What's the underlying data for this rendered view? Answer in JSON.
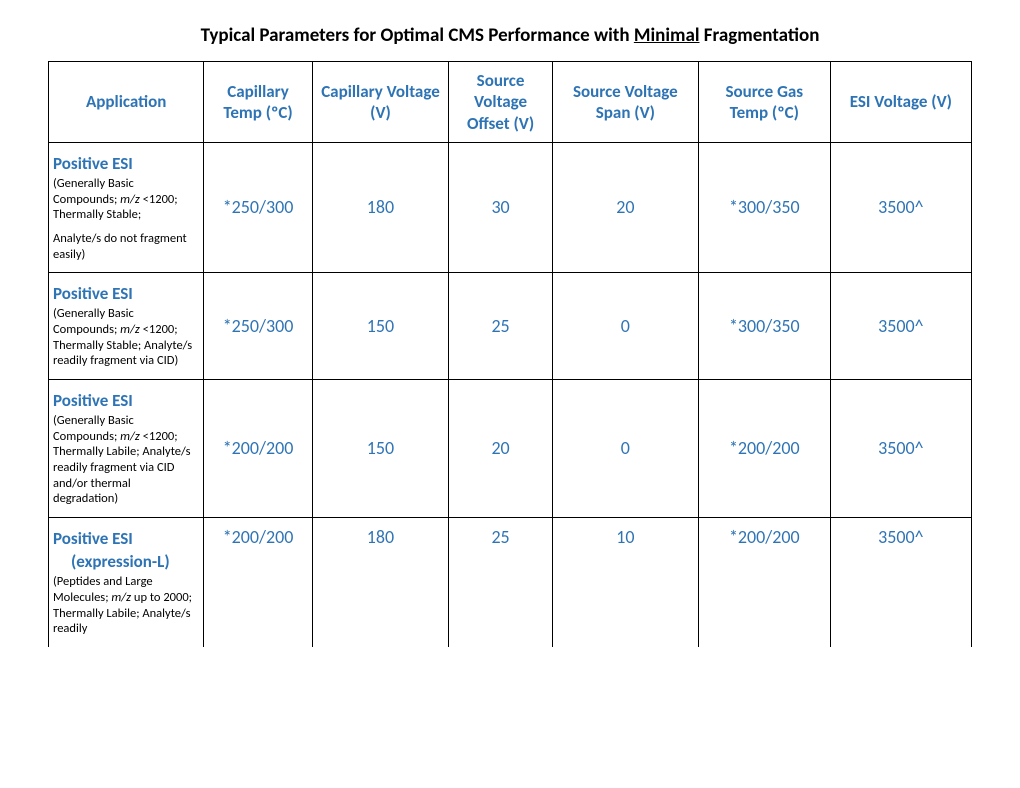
{
  "title_pre": "Typical Parameters for Optimal CMS Performance with ",
  "title_u": "Minimal",
  "title_post": " Fragmentation",
  "headers": {
    "application": "Application",
    "cap_temp": "Capillary Temp (ºC)",
    "cap_volt": "Capillary Voltage (V)",
    "src_v_off": "Source Voltage Offset (V)",
    "src_v_span": "Source Voltage Span (V)",
    "src_gas_temp": "Source Gas Temp (ºC)",
    "esi_v": "ESI Voltage (V)"
  },
  "rows": [
    {
      "app_name": "Positive ESI",
      "app_desc_1": "(Generally Basic Compounds; ",
      "app_desc_mz": "m/z",
      "app_desc_2": " <1200; Thermally Stable;",
      "app_desc_3": "Analyte/s do not fragment easily)",
      "cap_temp": "*250/300",
      "cap_volt": "180",
      "src_v_off": "30",
      "src_v_span": "20",
      "src_gas_temp": "*300/350",
      "esi_v": "3500^"
    },
    {
      "app_name": "Positive ESI",
      "app_desc_1": "(Generally Basic Compounds; ",
      "app_desc_mz": "m/z",
      "app_desc_2": " <1200; Thermally Stable; Analyte/s readily fragment via CID)",
      "app_desc_3": "",
      "cap_temp": "*250/300",
      "cap_volt": "150",
      "src_v_off": "25",
      "src_v_span": "0",
      "src_gas_temp": "*300/350",
      "esi_v": "3500^"
    },
    {
      "app_name": "Positive ESI",
      "app_desc_1": "(Generally Basic Compounds; ",
      "app_desc_mz": "m/z",
      "app_desc_2": " <1200; Thermally Labile; Analyte/s readily fragment via CID and/or thermal degradation)",
      "app_desc_3": "",
      "cap_temp": "*200/200",
      "cap_volt": "150",
      "src_v_off": "20",
      "src_v_span": "0",
      "src_gas_temp": "*200/200",
      "esi_v": "3500^"
    },
    {
      "app_name": "Positive ESI",
      "app_sub": "(expression-L)",
      "app_desc_1": "(Peptides and Large Molecules; ",
      "app_desc_mz": "m/z",
      "app_desc_2": " up to 2000; Thermally Labile; Analyte/s readily",
      "app_desc_3": "",
      "cap_temp": "*200/200",
      "cap_volt": "180",
      "src_v_off": "25",
      "src_v_span": "10",
      "src_gas_temp": "*200/200",
      "esi_v": "3500^"
    }
  ]
}
